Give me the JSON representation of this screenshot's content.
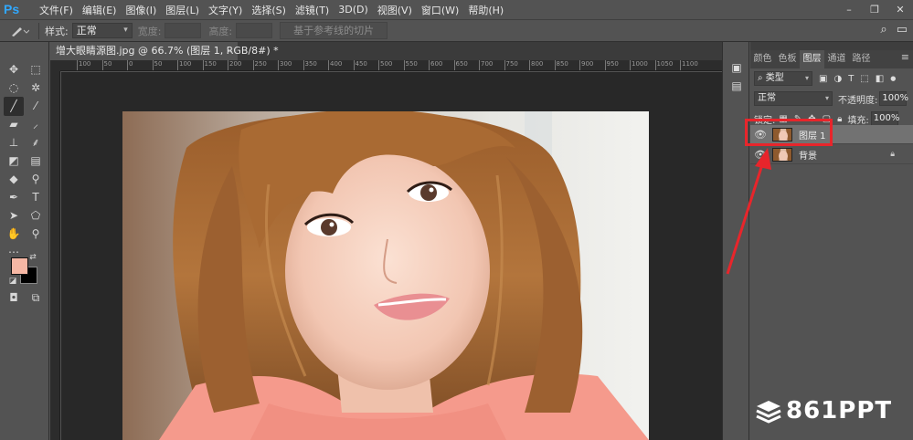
{
  "app": {
    "logo": "Ps"
  },
  "menu": [
    "文件(F)",
    "编辑(E)",
    "图像(I)",
    "图层(L)",
    "文字(Y)",
    "选择(S)",
    "滤镜(T)",
    "3D(D)",
    "视图(V)",
    "窗口(W)",
    "帮助(H)"
  ],
  "window_controls": {
    "minimize": "–",
    "restore": "❐",
    "close": "✕"
  },
  "options_bar": {
    "style_label": "样式:",
    "style_value": "正常",
    "width_label": "宽度:",
    "height_label": "高度:",
    "slice_button": "基于参考线的切片"
  },
  "document": {
    "tab_title": "增大眼睛源图.jpg @ 66.7% (图层 1, RGB/8#) *",
    "close": "×"
  },
  "ruler": {
    "h_ticks": [
      "100",
      "50",
      "0",
      "50",
      "100",
      "150",
      "200",
      "250",
      "300",
      "350",
      "400",
      "450",
      "500",
      "550",
      "600",
      "650",
      "700",
      "750",
      "800",
      "850",
      "900",
      "950",
      "1000",
      "1050",
      "1100"
    ]
  },
  "layers_panel": {
    "tabs": [
      "颜色",
      "色板",
      "图层",
      "通道",
      "路径"
    ],
    "active_tab": "图层",
    "filter_value": "类型",
    "blend_mode": "正常",
    "opacity_label": "不透明度:",
    "opacity_value": "100%",
    "lock_label": "锁定:",
    "fill_label": "填充:",
    "fill_value": "100%",
    "layers": [
      {
        "name": "图层 1",
        "selected": true
      },
      {
        "name": "背景",
        "locked": true
      }
    ]
  },
  "annotation": {
    "color": "#e8252b"
  },
  "watermark": {
    "text": "861PPT"
  },
  "colors": {
    "foreground": "#f6b7a4",
    "background": "#000000",
    "ps_blue": "#31a8ff"
  }
}
